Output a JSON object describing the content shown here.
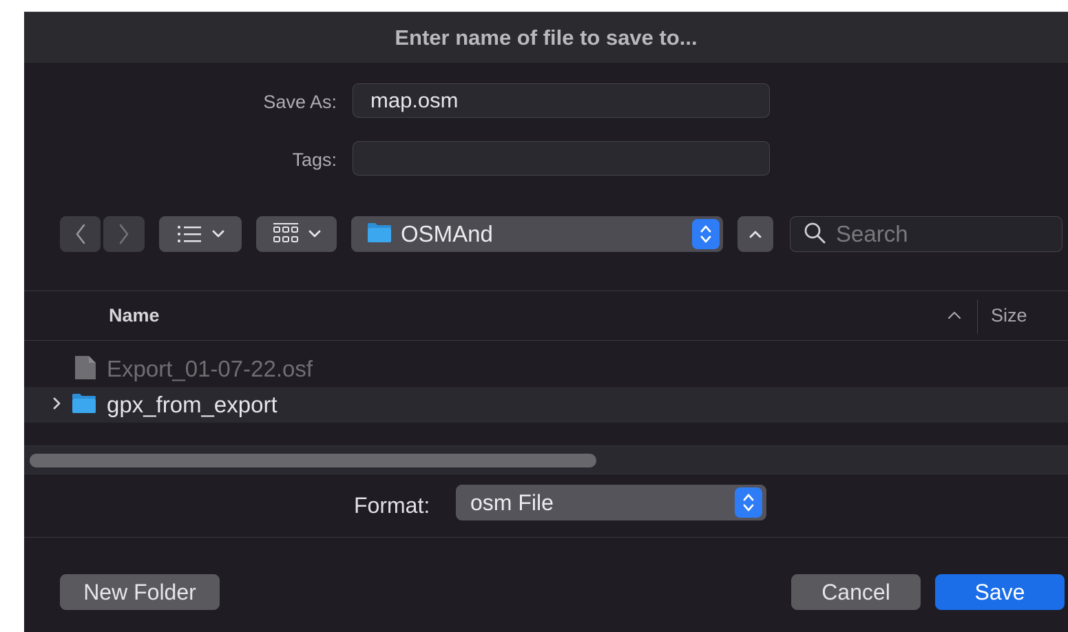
{
  "dialog": {
    "title": "Enter name of file to save to..."
  },
  "save_as": {
    "label": "Save As:",
    "value": "map.osm"
  },
  "tags": {
    "label": "Tags:",
    "value": ""
  },
  "toolbar": {
    "back_icon": "chevron-left-icon",
    "forward_icon": "chevron-right-icon",
    "list_view_icon": "list-view-icon",
    "icon_view_icon": "icon-grid-icon",
    "location": "OSMAnd",
    "collapse_icon": "chevron-up-icon",
    "search_placeholder": "Search"
  },
  "file_list": {
    "columns": [
      "Name",
      "Size"
    ],
    "sort_indicator": "chevron-up-icon",
    "items": [
      {
        "name": "Export_01-07-22.osf",
        "type": "file",
        "enabled": false
      },
      {
        "name": "gpx_from_export",
        "type": "folder",
        "enabled": true
      }
    ]
  },
  "format": {
    "label": "Format:",
    "value": "osm File"
  },
  "buttons": {
    "new_folder": "New Folder",
    "cancel": "Cancel",
    "save": "Save"
  },
  "colors": {
    "accent": "#1b6ee8",
    "folder": "#3aa7ee",
    "background": "#1f1d23"
  }
}
